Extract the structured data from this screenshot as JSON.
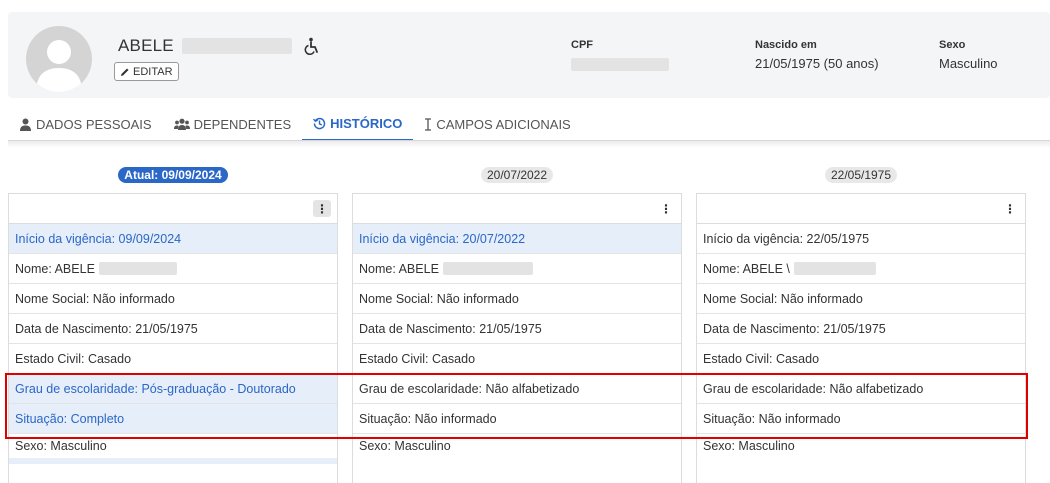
{
  "profile": {
    "name": "ABELE",
    "edit_label": "EDITAR",
    "cpf_label": "CPF",
    "birth_label": "Nascido em",
    "birth_value": "21/05/1975 (50 anos)",
    "sex_label": "Sexo",
    "sex_value": "Masculino"
  },
  "tabs": [
    {
      "label": "DADOS PESSOAIS",
      "icon": "user-icon",
      "active": false
    },
    {
      "label": "DEPENDENTES",
      "icon": "users-icon",
      "active": false
    },
    {
      "label": "HISTÓRICO",
      "icon": "history-icon",
      "active": true
    },
    {
      "label": "CAMPOS ADICIONAIS",
      "icon": "cursor-icon",
      "active": false
    }
  ],
  "colors": {
    "accent": "#2a67c7",
    "highlight_bg": "#e6eefa",
    "annotation": "#e00000"
  },
  "history": [
    {
      "date_label": "Atual: 09/09/2024",
      "rows": [
        "Início da vigência: 09/09/2024",
        "Nome: ABELE ",
        "Nome Social: Não informado",
        "Data de Nascimento: 21/05/1975",
        "Estado Civil: Casado",
        "Grau de escolaridade: Pós-graduação - Doutorado",
        "Situação: Completo",
        "Sexo: Masculino"
      ]
    },
    {
      "date_label": "20/07/2022",
      "rows": [
        "Início da vigência: 20/07/2022",
        "Nome: ABELE",
        "Nome Social: Não informado",
        "Data de Nascimento: 21/05/1975",
        "Estado Civil: Casado",
        "Grau de escolaridade: Não alfabetizado",
        "Situação: Não informado",
        "Sexo: Masculino"
      ]
    },
    {
      "date_label": "22/05/1975",
      "rows": [
        "Início da vigência: 22/05/1975",
        "Nome: ABELE \\",
        "Nome Social: Não informado",
        "Data de Nascimento: 21/05/1975",
        "Estado Civil: Casado",
        "Grau de escolaridade: Não alfabetizado",
        "Situação: Não informado",
        "Sexo: Masculino"
      ]
    }
  ]
}
